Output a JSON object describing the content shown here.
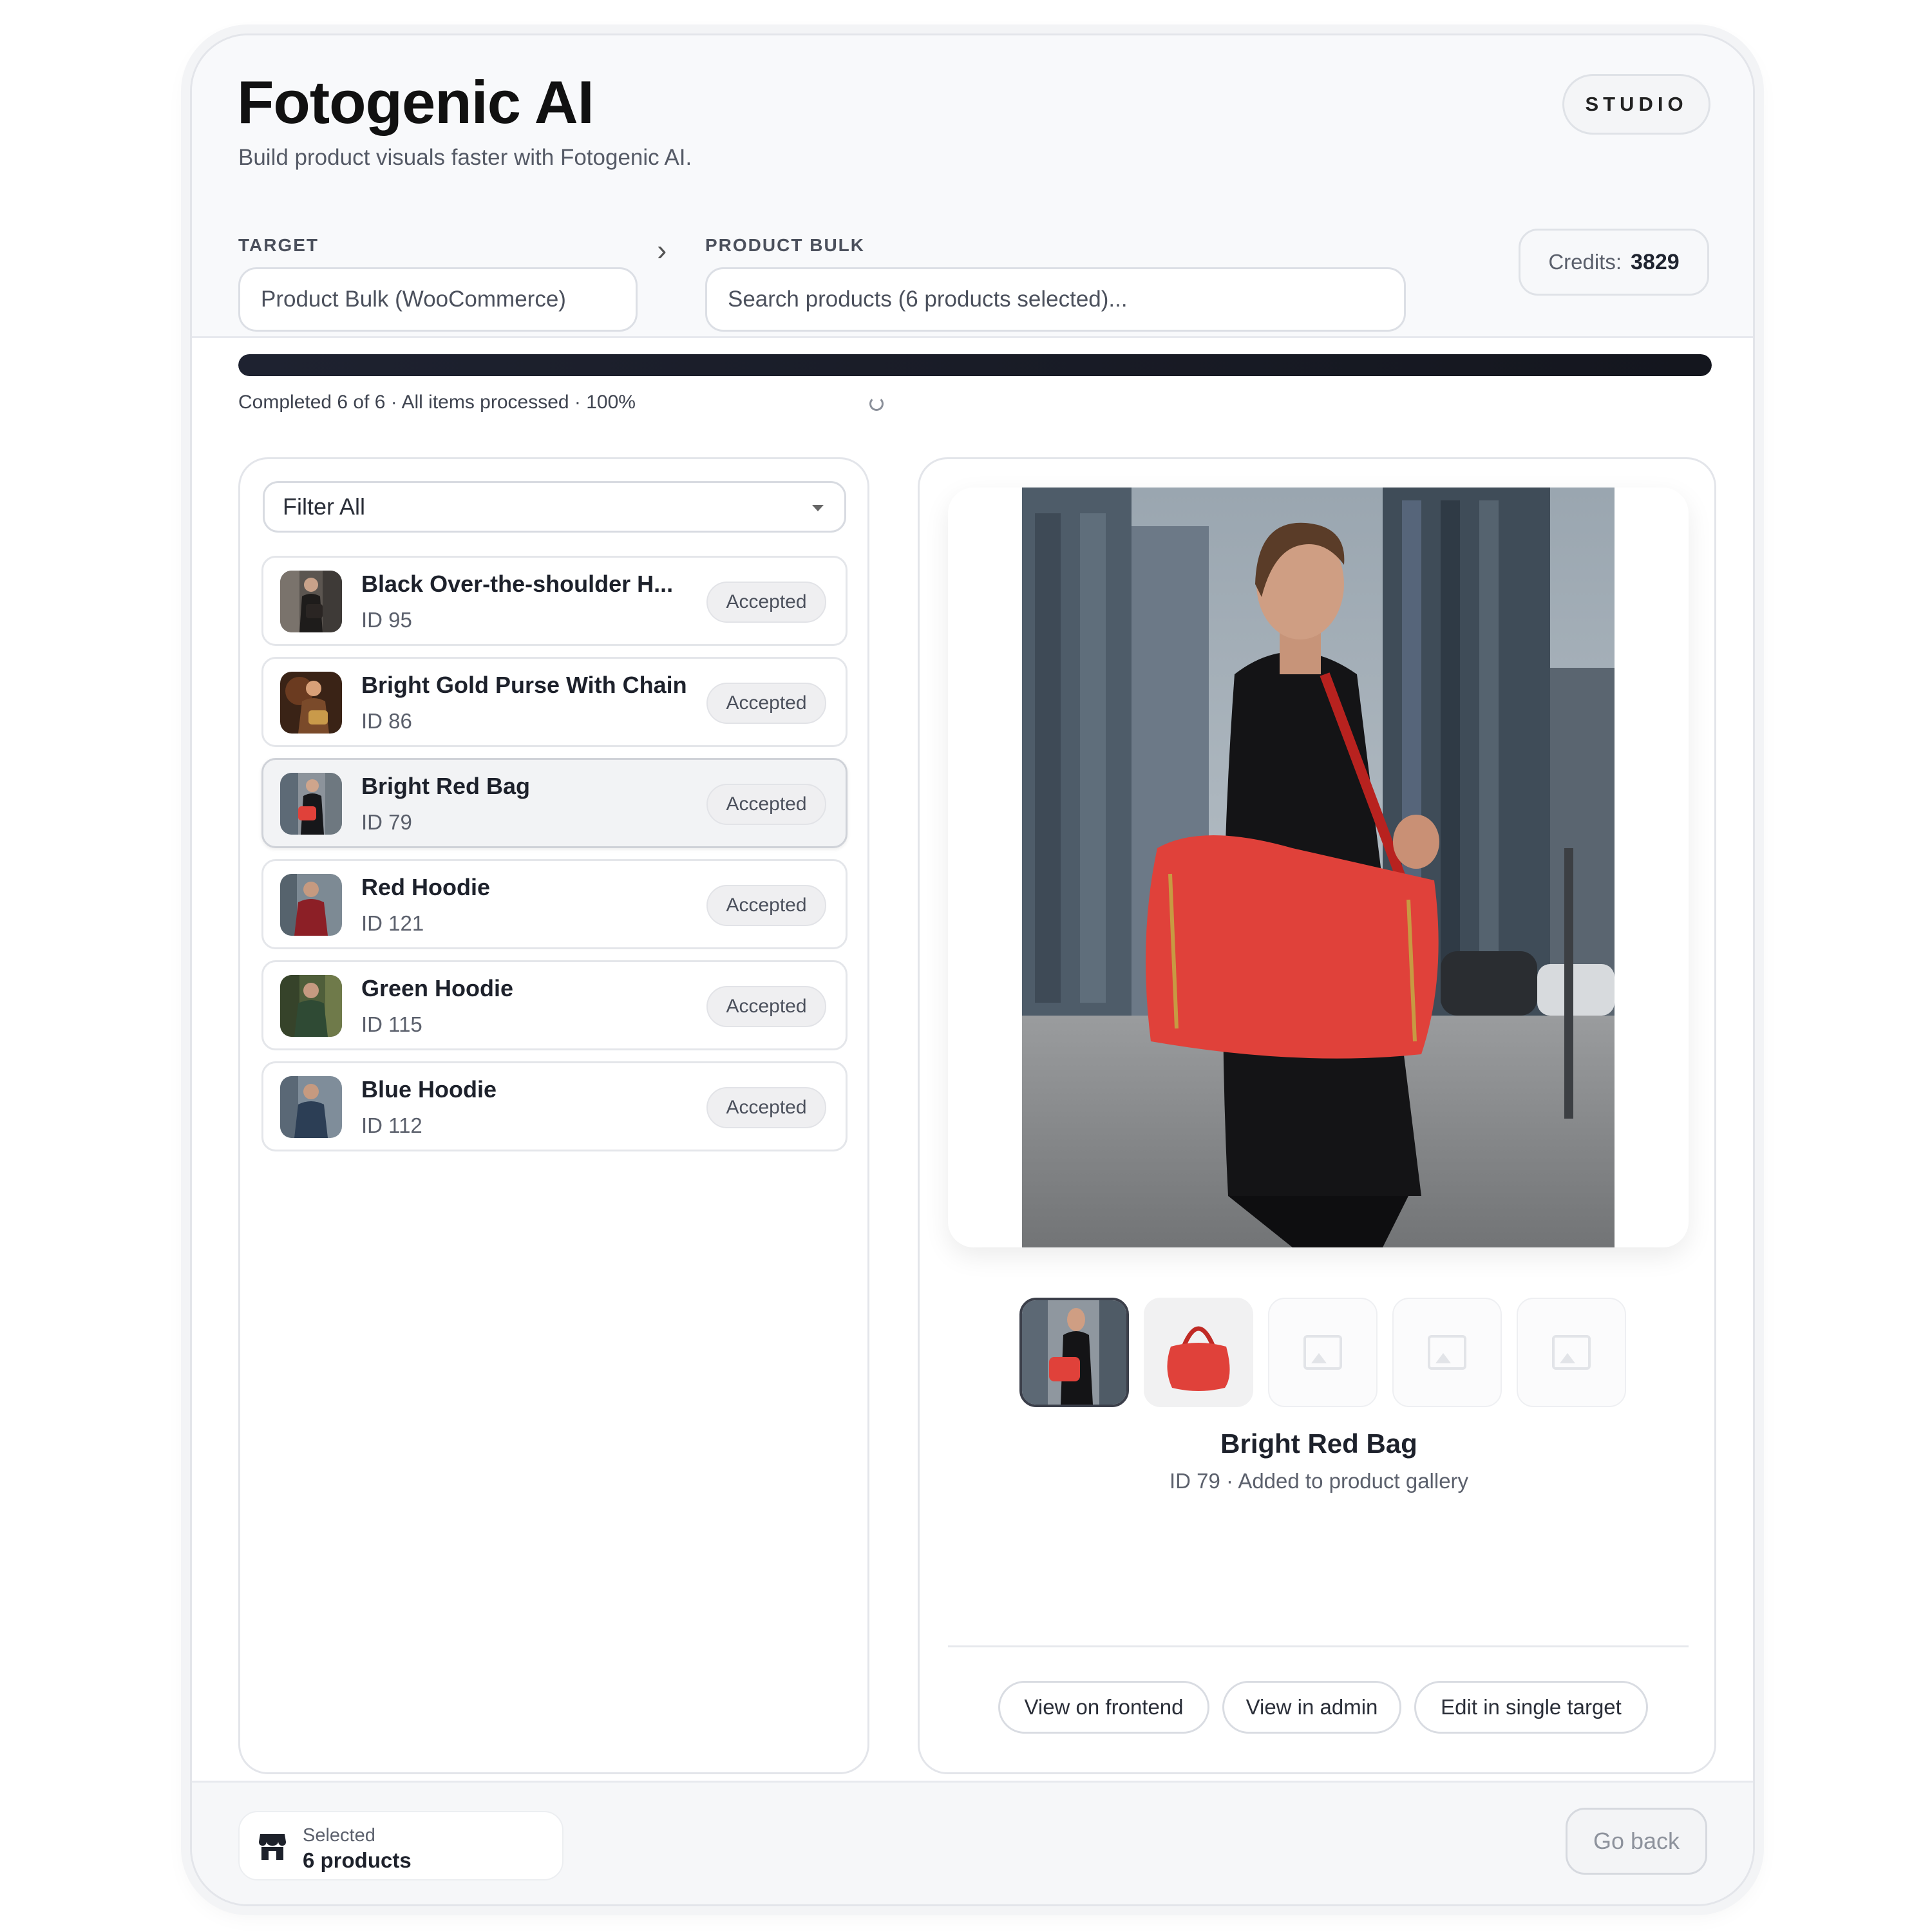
{
  "app": {
    "logo": "Fotogenic AI",
    "tagline": "Build product visuals faster with Fotogenic AI.",
    "badge": "STUDIO"
  },
  "target": {
    "label": "TARGET",
    "value": "Product Bulk (WooCommerce)"
  },
  "bulk": {
    "label": "PRODUCT BULK",
    "placeholder": "Search products (6 products selected)..."
  },
  "credits": {
    "label": "Credits:",
    "value": "3829"
  },
  "progress": {
    "percent": 100,
    "text": "Completed 6 of 6 · All items processed · 100%"
  },
  "filter": {
    "selected": "Filter All"
  },
  "items": [
    {
      "title": "Black Over-the-shoulder H...",
      "id": "ID 95",
      "status": "Accepted"
    },
    {
      "title": "Bright Gold Purse With Chain",
      "id": "ID 86",
      "status": "Accepted"
    },
    {
      "title": "Bright Red Bag",
      "id": "ID 79",
      "status": "Accepted"
    },
    {
      "title": "Red Hoodie",
      "id": "ID 121",
      "status": "Accepted"
    },
    {
      "title": "Green Hoodie",
      "id": "ID 115",
      "status": "Accepted"
    },
    {
      "title": "Blue Hoodie",
      "id": "ID 112",
      "status": "Accepted"
    }
  ],
  "detail": {
    "title": "Bright Red Bag",
    "subtitle": "ID 79 · Added to product gallery"
  },
  "actions": {
    "frontend": "View on frontend",
    "admin": "View in admin",
    "single": "Edit in single target"
  },
  "footer": {
    "selected_label": "Selected",
    "selected_value": "6 products",
    "go_back": "Go back"
  },
  "icons": {
    "chevron": "chevron-right-icon",
    "spinner": "loading-spinner-icon",
    "store": "store-icon",
    "image_placeholder": "image-placeholder-icon"
  },
  "colors": {
    "progress": "#1e2230",
    "accent_red": "#e0413a"
  }
}
